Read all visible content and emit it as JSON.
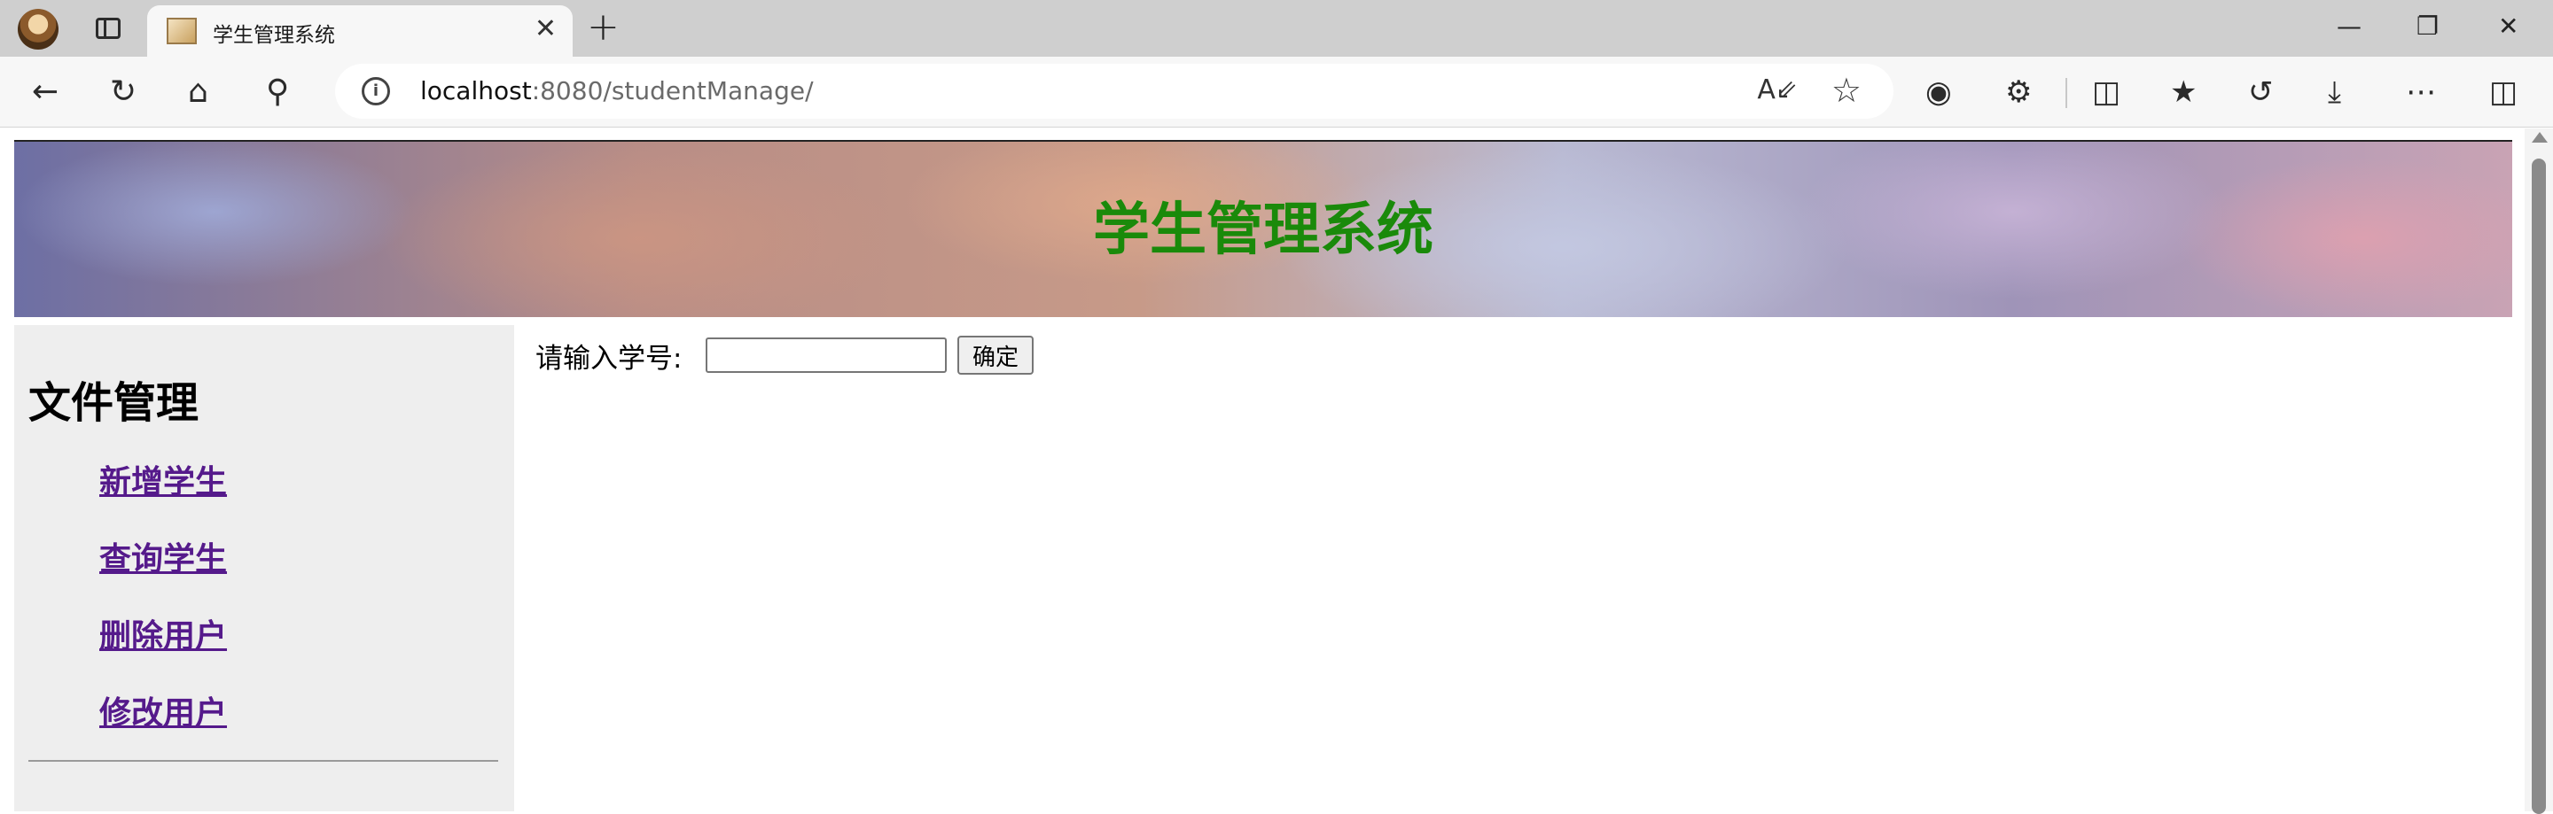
{
  "browser": {
    "tab_title": "学生管理系统",
    "tab_close": "✕",
    "new_tab": "+",
    "url_host": "localhost",
    "url_rest": ":8080/studentManage/"
  },
  "page": {
    "banner_title": "学生管理系统",
    "sidebar": {
      "heading": "文件管理",
      "links": [
        "新增学生",
        "查询学生",
        "删除用户",
        "修改用户"
      ]
    },
    "search": {
      "label": "请输入学号:",
      "value": "",
      "submit": "确定"
    }
  },
  "colors": {
    "banner_title": "#1a8a0a",
    "link": "#551a8b",
    "sidebar_bg": "#eeeeee"
  }
}
